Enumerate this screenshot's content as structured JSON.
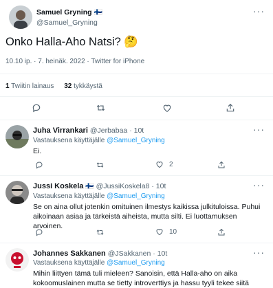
{
  "main_tweet": {
    "author_name": "Samuel Gryning",
    "flag": "🇫🇮",
    "author_handle": "@Samuel_Gryning",
    "text": "Onko Halla-Aho Natsi?",
    "emoji": "🤔",
    "meta": "10.10 ip. · 7. heinäk. 2022 · Twitter for iPhone",
    "quotes_count": "1",
    "quotes_label": "Twiitin lainaus",
    "likes_count": "32",
    "likes_label": "tykkäystä"
  },
  "replies": [
    {
      "author_name": "Juha Virrankari",
      "author_handle": "@Jerbabaa",
      "time": "· 10t",
      "reply_to_prefix": "Vastauksena käyttäjälle",
      "reply_to_handle": "@Samuel_Gryning",
      "text": "Ei.",
      "like_count": "2"
    },
    {
      "author_name": "Jussi Koskela",
      "flag": "🇫🇮",
      "author_handle": "@JussiKoskela8",
      "time": "· 10t",
      "reply_to_prefix": "Vastauksena käyttäjälle",
      "reply_to_handle": "@Samuel_Gryning",
      "text": "Se on aina ollut jotenkin omituinen ilmestys kaikissa julkituloissa. Puhui aikoinaan asiaa ja tärkeistä aiheista, mutta silti. Ei luottamuksen arvoinen.",
      "like_count": "10"
    },
    {
      "author_name": "Johannes Sakkanen",
      "author_handle": "@JSakkanen",
      "time": "· 10t",
      "reply_to_prefix": "Vastauksena käyttäjälle",
      "reply_to_handle": "@Samuel_Gryning",
      "text": "Mihin liittyen tämä tuli mieleen? Sanoisin, että Halla-aho on aika kokoomuslainen mutta se tietty introverttiys ja hassu tyyli tekee siitä"
    }
  ],
  "icons": {
    "more": "more-icon",
    "reply": "reply-icon",
    "retweet": "retweet-icon",
    "like": "like-icon",
    "share": "share-icon"
  }
}
